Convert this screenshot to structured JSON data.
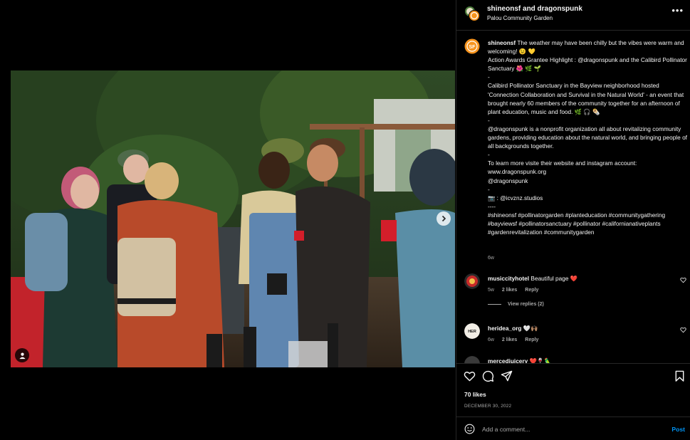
{
  "post_header": {
    "title": "shineonsf and dragonspunk",
    "location": "Palou Community Garden",
    "more_icon": "more-horizontal-icon"
  },
  "caption": {
    "username": "shineonsf",
    "lines": [
      "The weather may have been chilly but the vibes were warm and welcoming! 😉 💛",
      "Action Awards Grantee Highlight : @dragonspunk and the Calibird Pollinator Sanctuary 🌺 🌿 🌱",
      "-",
      "Calibird Pollinator Sanctuary in the Bayview neighborhood hosted 'Connection Collaboration and Survival in the Natural World' - an event that brought nearly 60 members of the community together for an afternoon of plant education, music and food. 🌿 🎧 🌯",
      "-",
      "@dragonspunk is a nonprofit organization all about revitalizing community gardens, providing education about the natural world, and bringing people of all backgrounds together.",
      "-",
      "To learn more visite their website and instagram account:",
      "www.dragonspunk.org",
      "@dragonspunk",
      "-",
      "📷 : @icvznz.studios",
      "----",
      "#shineonsf #pollinatorgarden #planteducation #communitygathering #bayviewsf #pollinatorsanctuary #pollinator #californianativeplants #gardenrevitalization #communitygarden"
    ],
    "time": "6w"
  },
  "comments": [
    {
      "username": "musiccityhotel",
      "text": "Beautiful page ❤️",
      "time": "5w",
      "likes": "2 likes",
      "reply": "Reply",
      "view_replies": "View replies (2)"
    },
    {
      "username": "heridea_org",
      "text": "🤍🙌🏽",
      "time": "6w",
      "likes": "2 likes",
      "reply": "Reply"
    },
    {
      "username": "mercedjuicery",
      "text": "❤️🍷🦜"
    }
  ],
  "actions": {
    "like_icon": "heart-icon",
    "comment_icon": "comment-icon",
    "share_icon": "send-icon",
    "save_icon": "bookmark-icon"
  },
  "likes": "70 likes",
  "date": "DECEMBER 30, 2022",
  "add_comment": {
    "placeholder": "Add a comment...",
    "post_label": "Post",
    "emoji_icon": "emoji-icon"
  },
  "media": {
    "next_icon": "chevron-right-icon",
    "tag_icon": "user-tag-icon"
  },
  "colors": {
    "background": "#000000",
    "text": "#f5f5f5",
    "muted": "#a8a8a8",
    "link": "#0095f6",
    "like_red": "#ff3040",
    "brand_orange": "#f7941d"
  }
}
